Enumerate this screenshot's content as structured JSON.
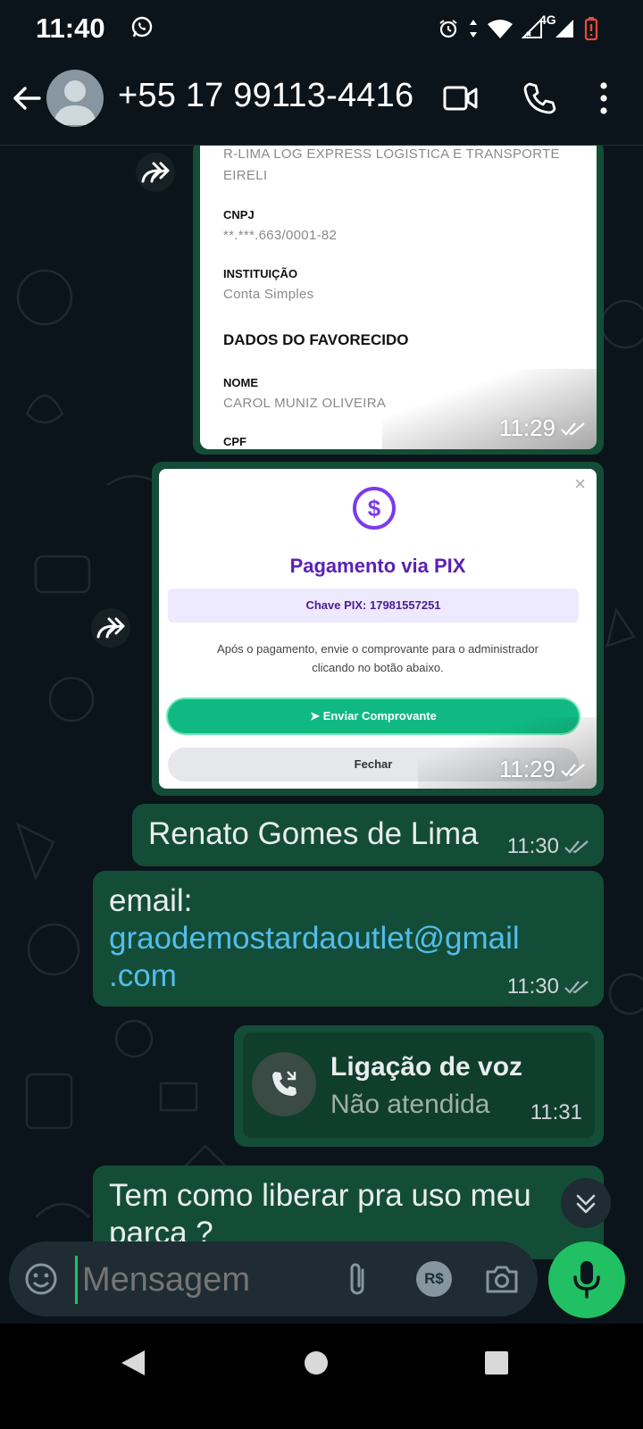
{
  "status_bar": {
    "time": "11:40",
    "network": "4G"
  },
  "header": {
    "contact": "+55 17 99113-4416"
  },
  "messages": {
    "doc": {
      "company": "R-LIMA LOG EXPRESS LOGISTICA E TRANSPORTE EIRELI",
      "cnpj_label": "CNPJ",
      "cnpj_value": "**.***.663/0001-82",
      "inst_label": "INSTITUIÇÃO",
      "inst_value": "Conta Simples",
      "section": "DADOS DO FAVORECIDO",
      "nome_label": "NOME",
      "nome_value": "CAROL MUNIZ OLIVEIRA",
      "cpf_label": "CPF",
      "time": "11:29"
    },
    "pix": {
      "close": "×",
      "title": "Pagamento via PIX",
      "key": "Chave PIX: 17981557251",
      "desc1": "Após o pagamento, envie o comprovante para o administrador",
      "desc2": "clicando no botão abaixo.",
      "send": "Enviar Comprovante",
      "close_btn": "Fechar",
      "time": "11:29"
    },
    "name_msg": {
      "text": "Renato Gomes de Lima",
      "time": "11:30"
    },
    "email_msg": {
      "line1": "email:",
      "email1": "graodemostardaoutlet@gmail",
      "email2": ".com",
      "time": "11:30"
    },
    "call_msg": {
      "title": "Ligação de voz",
      "status": "Não atendida",
      "time": "11:31"
    },
    "last_msg": {
      "line1": "Tem como liberar pra uso meu",
      "line2": "parça ?"
    }
  },
  "composer": {
    "placeholder": "Mensagem",
    "currency": "R$"
  },
  "colors": {
    "bubble_out": "#144d37",
    "accent": "#21c063",
    "link": "#53bdeb",
    "pix_purple": "#5b21b6"
  }
}
